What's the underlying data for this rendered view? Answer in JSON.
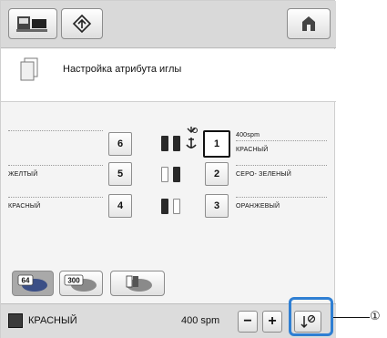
{
  "header": {
    "title": "Настройка атрибута иглы"
  },
  "needles": {
    "left": [
      {
        "number": "6",
        "label": ""
      },
      {
        "number": "5",
        "label": "ЖЕЛТЫЙ"
      },
      {
        "number": "4",
        "label": "КРАСНЫЙ"
      }
    ],
    "right": [
      {
        "number": "1",
        "speed": "400spm",
        "label": "КРАСНЫЙ"
      },
      {
        "number": "2",
        "label": "СЕРО- ЗЕЛЕНЫЙ"
      },
      {
        "number": "3",
        "label": "ОРАНЖЕВЫЙ"
      }
    ]
  },
  "mode_buttons": {
    "speed_badge_64": "64",
    "speed_badge_300": "300"
  },
  "status": {
    "color_name": "КРАСНЫЙ",
    "speed": "400 spm",
    "minus": "−",
    "plus": "+",
    "swatch_color": "#3a3a3a"
  },
  "annotation": {
    "callout_number": "①"
  }
}
